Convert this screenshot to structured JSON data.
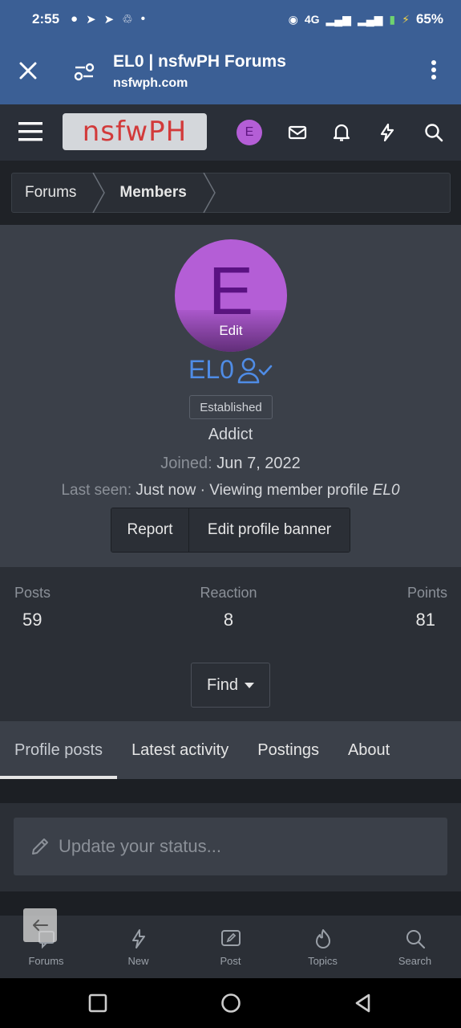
{
  "status_bar": {
    "time": "2:55",
    "network": "4G",
    "battery": "65%"
  },
  "browser": {
    "title": "EL0 | nsfwPH Forums",
    "url": "nsfwph.com"
  },
  "header": {
    "logo_text": "nsfwPH",
    "avatar_letter": "E"
  },
  "breadcrumb": [
    "Forums",
    "Members"
  ],
  "profile": {
    "avatar_letter": "E",
    "avatar_edit": "Edit",
    "username": "EL0",
    "badge": "Established",
    "rank": "Addict",
    "joined_label": "Joined:",
    "joined_value": "Jun 7, 2022",
    "lastseen_label": "Last seen:",
    "lastseen_value": "Just now · Viewing member profile",
    "lastseen_member": "EL0",
    "report_button": "Report",
    "banner_button": "Edit profile banner"
  },
  "stats": {
    "posts_label": "Posts",
    "posts_value": "59",
    "reaction_label": "Reaction",
    "reaction_value": "8",
    "points_label": "Points",
    "points_value": "81",
    "find_button": "Find"
  },
  "tabs": [
    "Profile posts",
    "Latest activity",
    "Postings",
    "About"
  ],
  "status_update": {
    "placeholder": "Update your status..."
  },
  "bottom_nav": [
    "Forums",
    "New",
    "Post",
    "Topics",
    "Search"
  ],
  "colors": {
    "browser_bar": "#3b5f95",
    "avatar": "#b45ed6",
    "username": "#4f8ce6"
  }
}
